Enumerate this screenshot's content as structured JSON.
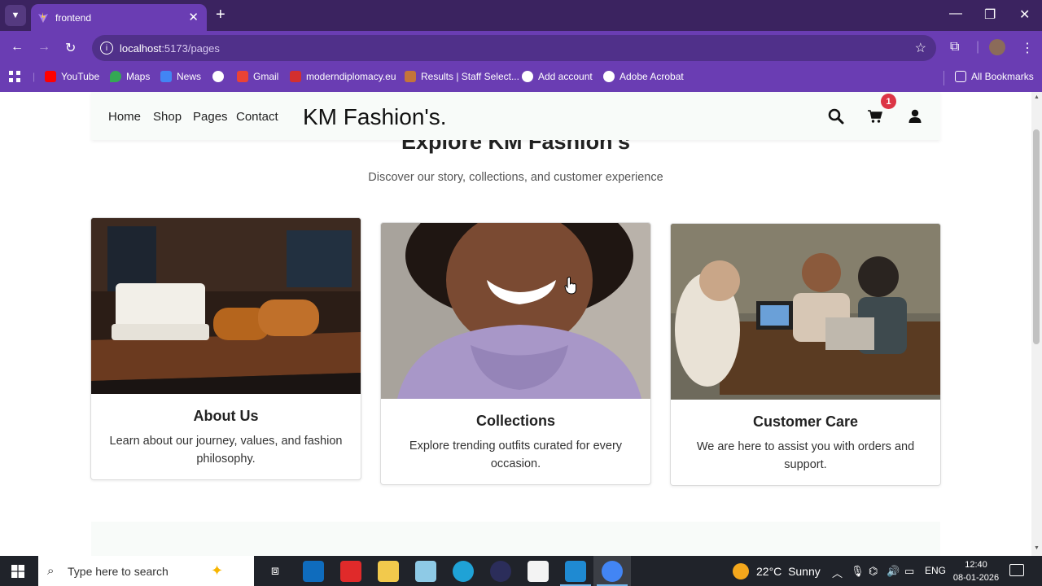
{
  "browser": {
    "tab_title": "frontend",
    "url_host": "localhost",
    "url_path": ":5173/pages",
    "bookmarks": [
      "YouTube",
      "Maps",
      "News",
      "Gmail",
      "moderndiplomacy.eu",
      "Results | Staff Select...",
      "Add account",
      "Adobe Acrobat"
    ],
    "all_bookmarks": "All Bookmarks"
  },
  "site": {
    "nav": [
      "Home",
      "Shop",
      "Pages",
      "Contact"
    ],
    "brand": "KM Fashion's.",
    "cart_count": "1",
    "heading": "Explore KM Fashion's",
    "subheading": "Discover our story, collections, and customer experience",
    "cards": [
      {
        "title": "About Us",
        "text": "Learn about our journey, values, and fashion philosophy."
      },
      {
        "title": "Collections",
        "text": "Explore trending outfits curated for every occasion."
      },
      {
        "title": "Customer Care",
        "text": "We are here to assist you with orders and support."
      }
    ]
  },
  "taskbar": {
    "search_placeholder": "Type here to search",
    "weather_temp": "22°C",
    "weather_cond": "Sunny",
    "lang": "ENG",
    "time": "12:40",
    "date": "08-01-2026"
  },
  "colors": {
    "tabbar": "#3b2360",
    "toolbar": "#6a3db3",
    "badge": "#dc3545",
    "nav_bg": "#f8fbf9"
  }
}
